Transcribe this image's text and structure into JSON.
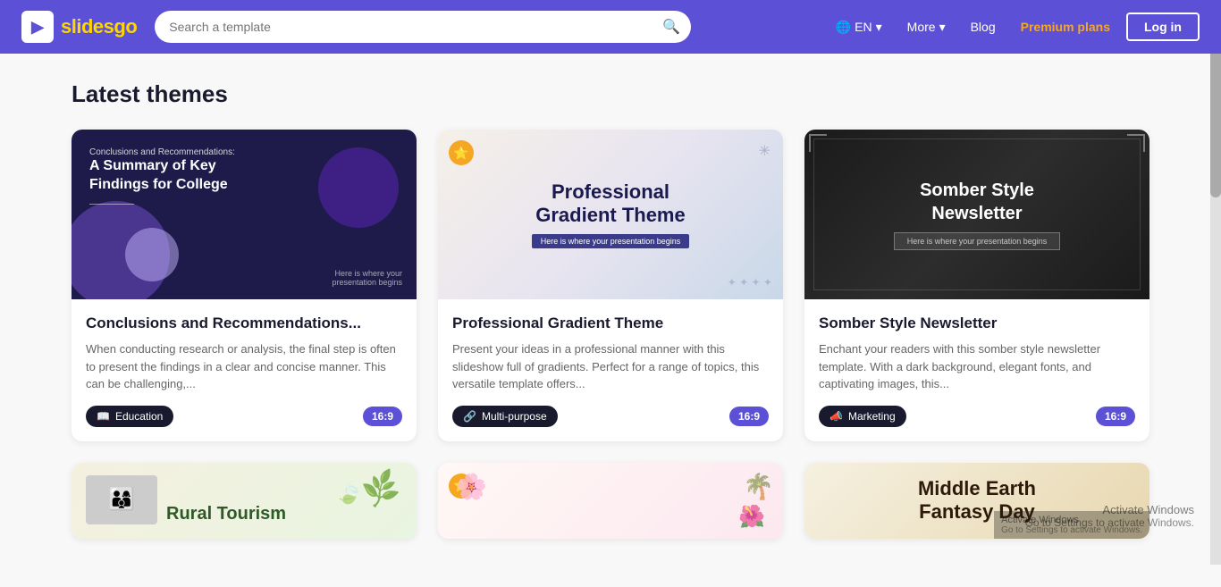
{
  "header": {
    "logo_text_slides": "slides",
    "logo_text_go": "go",
    "search_placeholder": "Search a template",
    "lang": "EN",
    "nav_more": "More",
    "nav_blog": "Blog",
    "nav_premium": "Premium plans",
    "nav_login": "Log in"
  },
  "main": {
    "section_title": "Latest themes",
    "cards": [
      {
        "id": "card-1",
        "thumb_label_small": "Conclusions and Recommendations:",
        "thumb_label_big": "A Summary of Key\nFindings for College",
        "thumb_sub": "Here is where your\npresentation begins",
        "title": "Conclusions and Recommendations...",
        "desc": "When conducting research or analysis, the final step is often to present the findings in a clear and concise manner. This can be challenging,...",
        "tag": "Education",
        "tag_icon": "📖",
        "ratio": "16:9"
      },
      {
        "id": "card-2",
        "thumb_title": "Professional\nGradient Theme",
        "thumb_sub": "Here is where your presentation begins",
        "title": "Professional Gradient Theme",
        "desc": "Present your ideas in a professional manner with this slideshow full of gradients. Perfect for a range of topics, this versatile template offers...",
        "tag": "Multi-purpose",
        "tag_icon": "🔗",
        "ratio": "16:9",
        "premium": true
      },
      {
        "id": "card-3",
        "thumb_title": "Somber Style\nNewsletter",
        "thumb_sub": "Here is where your presentation begins",
        "title": "Somber Style Newsletter",
        "desc": "Enchant your readers with this somber style newsletter template. With a dark background, elegant fonts, and captivating images, this...",
        "tag": "Marketing",
        "tag_icon": "📣",
        "ratio": "16:9"
      }
    ],
    "bottom_cards": [
      {
        "id": "card-4",
        "thumb_title": "Rural Tourism",
        "title": "Rural Tourism",
        "desc": ""
      },
      {
        "id": "card-5",
        "thumb_title": "",
        "title": "",
        "desc": "",
        "premium": true
      },
      {
        "id": "card-6",
        "thumb_title": "Middle Earth\nFantasy Day",
        "title": "Middle Earth Fantasy Day",
        "desc": ""
      }
    ]
  },
  "activate_windows": {
    "title": "Activate Windows",
    "subtitle": "Go to Settings to activate Windows."
  }
}
